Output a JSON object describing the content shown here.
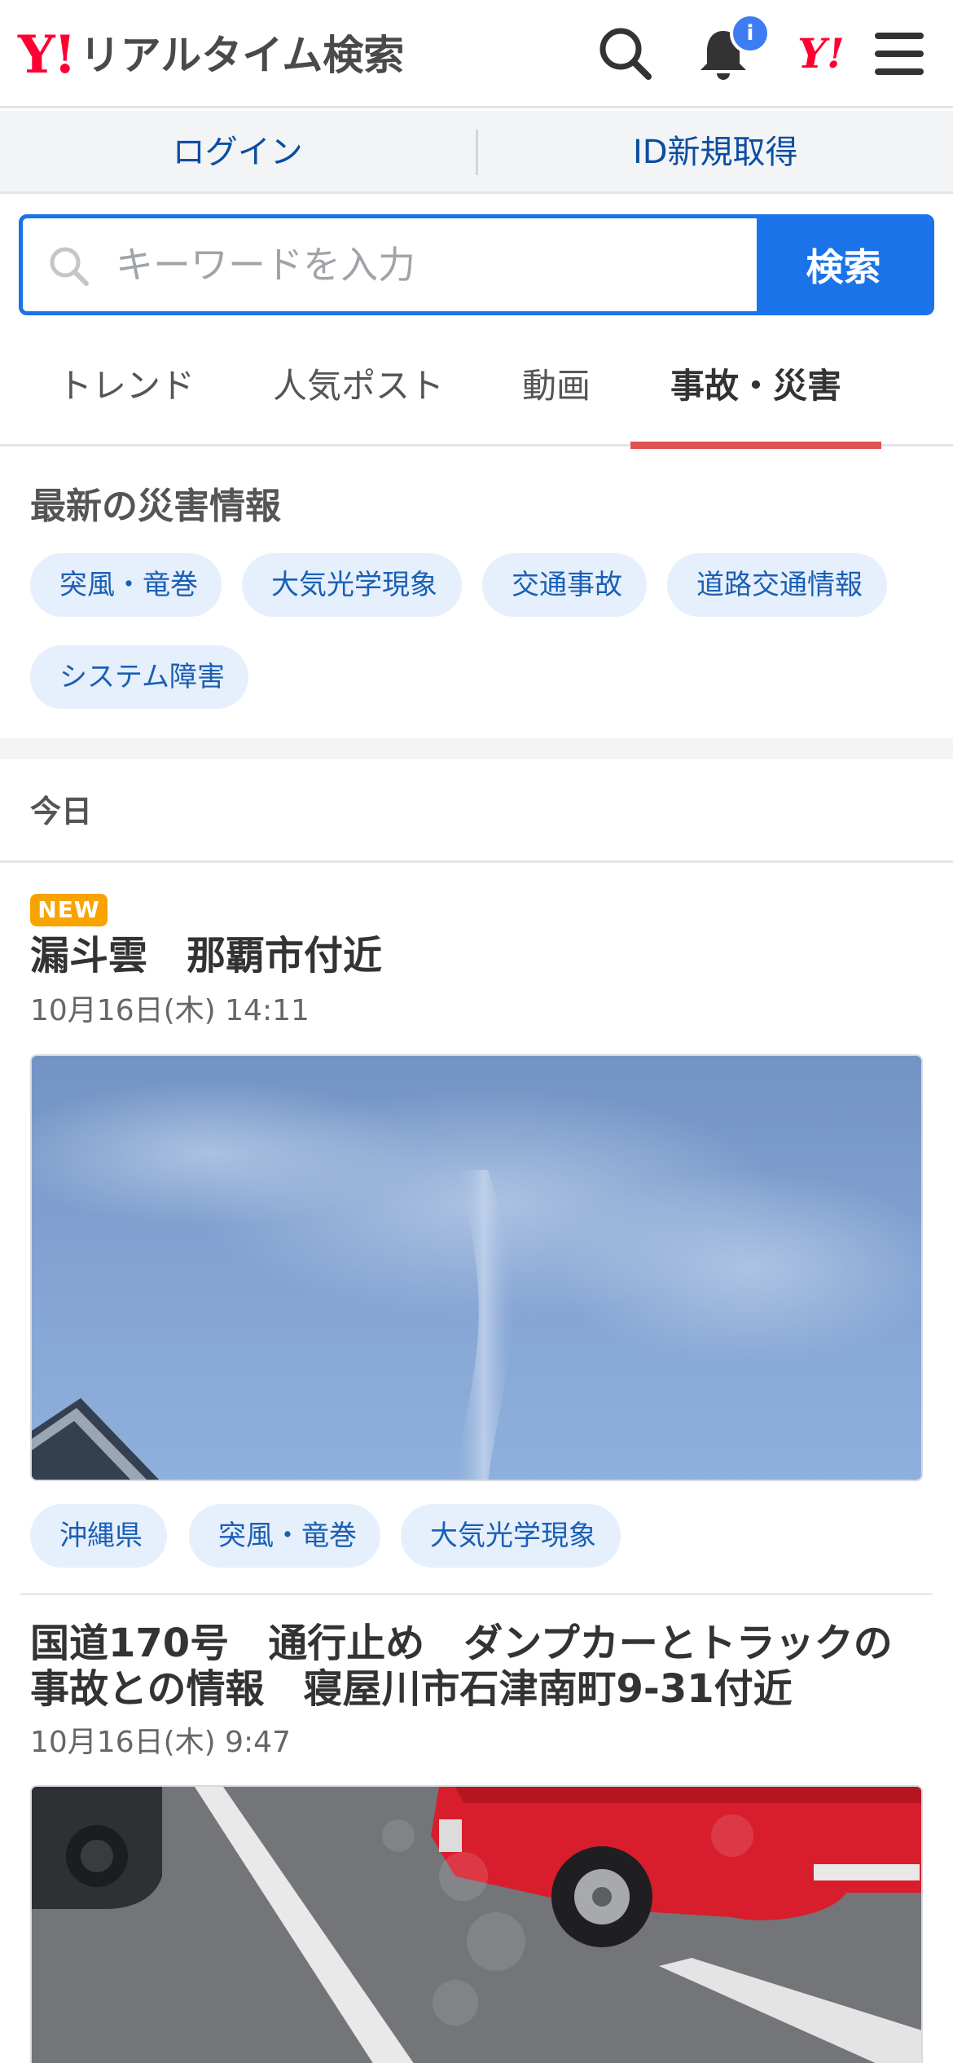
{
  "header": {
    "logo_y": "Y!",
    "logo_text": "リアルタイム検索",
    "notification_badge": "i",
    "yjapan_mark": "Y!"
  },
  "account": {
    "login": "ログイン",
    "signup": "ID新規取得"
  },
  "search": {
    "placeholder": "キーワードを入力",
    "button": "検索"
  },
  "tabs": [
    {
      "label": "トレンド",
      "active": false
    },
    {
      "label": "人気ポスト",
      "active": false
    },
    {
      "label": "動画",
      "active": false
    },
    {
      "label": "事故・災害",
      "active": true
    }
  ],
  "disaster": {
    "title": "最新の災害情報",
    "chips": [
      "突風・竜巻",
      "大気光学現象",
      "交通事故",
      "道路交通情報",
      "システム障害"
    ]
  },
  "day_label": "今日",
  "posts": [
    {
      "badge": "NEW",
      "title": "漏斗雲　那覇市付近",
      "date": "10月16日(木) 14:11",
      "tags": [
        "沖縄県",
        "突風・竜巻",
        "大気光学現象"
      ]
    },
    {
      "title_line1": "国道170号　通行止め　ダンプカーとトラックの",
      "title_line2": "事故との情報　寝屋川市石津南町9-31付近",
      "date": "10月16日(木) 9:47"
    }
  ],
  "icons": {
    "search": "search-icon",
    "bell": "bell-icon",
    "menu": "hamburger-menu-icon"
  },
  "colors": {
    "brand_red": "#ff0033",
    "accent_blue": "#1a73e8",
    "chip_bg": "#e6effc",
    "chip_text": "#1a5fb4",
    "active_tab_underline": "#e05252",
    "new_badge": "#f8a300"
  }
}
